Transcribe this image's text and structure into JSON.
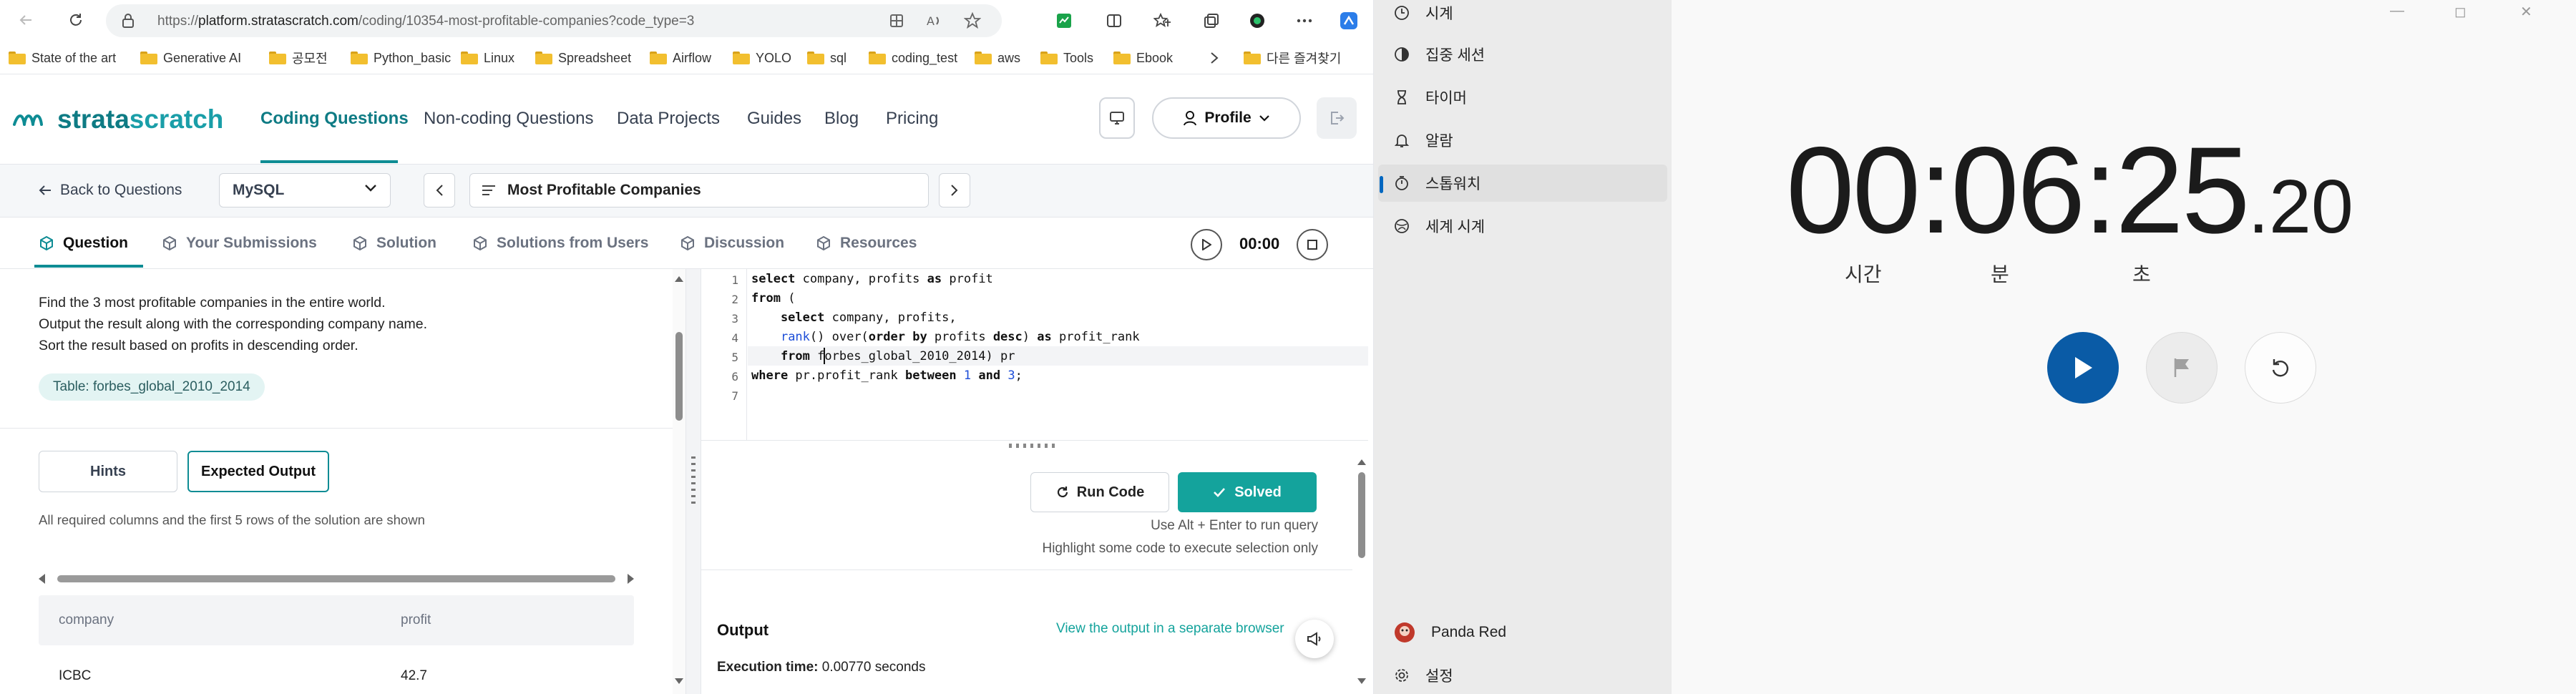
{
  "browser": {
    "url_prefix": "https://",
    "url_host": "platform.stratascratch.com",
    "url_path": "/coding/10354-most-profitable-companies?code_type=3",
    "bookmarks": [
      "State of the art",
      "Generative AI",
      "공모전",
      "Python_basic",
      "Linux",
      "Spreadsheet",
      "Airflow",
      "YOLO",
      "sql",
      "coding_test",
      "aws",
      "Tools",
      "Ebook"
    ],
    "other_bookmarks": "다른 즐겨찾기"
  },
  "site": {
    "logo_part1": "strata",
    "logo_part2": "scratch",
    "nav": [
      "Coding Questions",
      "Non-coding Questions",
      "Data Projects",
      "Guides",
      "Blog",
      "Pricing"
    ],
    "profile_label": "Profile"
  },
  "question_bar": {
    "back_label": "Back to Questions",
    "language": "MySQL",
    "title": "Most Profitable Companies"
  },
  "tabs": [
    "Question",
    "Your Submissions",
    "Solution",
    "Solutions from Users",
    "Discussion",
    "Resources"
  ],
  "timer": "00:00",
  "question": {
    "lines": [
      "Find the 3 most profitable companies in the entire world.",
      "Output the result along with the corresponding company name.",
      "Sort the result based on profits in descending order."
    ],
    "table_chip": "Table: forbes_global_2010_2014",
    "hints_label": "Hints",
    "expected_label": "Expected Output",
    "solution_note": "All required columns and the first 5 rows of the solution are shown",
    "columns": [
      "company",
      "profit"
    ],
    "rows": [
      [
        "ICBC",
        "42.7"
      ]
    ]
  },
  "editor": {
    "line_numbers": [
      "1",
      "2",
      "3",
      "4",
      "5",
      "6",
      "7"
    ],
    "code": {
      "l1a": "select",
      "l1b": " company, profits ",
      "l1c": "as",
      "l1d": " profit",
      "l2a": "from",
      "l2b": " (",
      "l3a": "    select",
      "l3b": " company, profits,",
      "l4a": "    ",
      "l4b": "rank",
      "l4c": "() over(",
      "l4d": "order by",
      "l4e": " profits ",
      "l4f": "desc",
      "l4g": ") ",
      "l4h": "as",
      "l4i": " profit_rank",
      "l5a": "    from",
      "l5b": " forbes_global_2010_2014) pr",
      "l6a": "where",
      "l6b": " pr.profit_rank ",
      "l6c": "between",
      "l6d": " ",
      "l6e": "1",
      "l6f": " ",
      "l6g": "and",
      "l6h": " ",
      "l6i": "3",
      "l6j": ";"
    }
  },
  "run": {
    "run_label": "Run Code",
    "solved_label": "Solved",
    "hint1": "Use Alt + Enter to run query",
    "hint2": "Highlight some code to execute selection only",
    "output_label": "Output",
    "output_link": "View the output in a separate browser",
    "exec_label": "Execution time:",
    "exec_value": " 0.00770 seconds"
  },
  "clock": {
    "sidebar": [
      "시계",
      "집중 세션",
      "타이머",
      "알람",
      "스톱워치",
      "세계 시계"
    ],
    "user": "Panda Red",
    "settings": "설정",
    "stopwatch_main": "00:06:25",
    "stopwatch_centi": ".20",
    "units": [
      "시간",
      "분",
      "초"
    ],
    "accent": "#0a5ba6"
  },
  "colors": {
    "brand": "#0e8c94",
    "solved": "#14a39c"
  }
}
